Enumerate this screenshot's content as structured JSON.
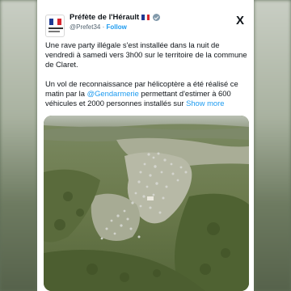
{
  "account": {
    "name": "Préfète de l'Hérault",
    "handle": "@Prefet34",
    "separator": "·",
    "follow_label": "Follow",
    "flag_icon": "france-flag-icon",
    "verified_icon": "verified-badge-icon"
  },
  "platform": {
    "logo": "X"
  },
  "tweet": {
    "paragraph1": "Une rave party illégale s'est installée dans la nuit de vendredi à samedi vers 3h00 sur le territoire de la commune de Claret.",
    "paragraph2_before": "Un vol de reconnaissance par hélicoptère a été réalisé ce matin par la ",
    "mention": "@Gendarmerie",
    "paragraph2_after": " permettant d'estimer à 600 véhicules et 2000 personnes installés sur ",
    "show_more": "Show more"
  },
  "colors": {
    "link": "#1d9bf0",
    "text": "#0f1419",
    "secondary": "#536471"
  }
}
